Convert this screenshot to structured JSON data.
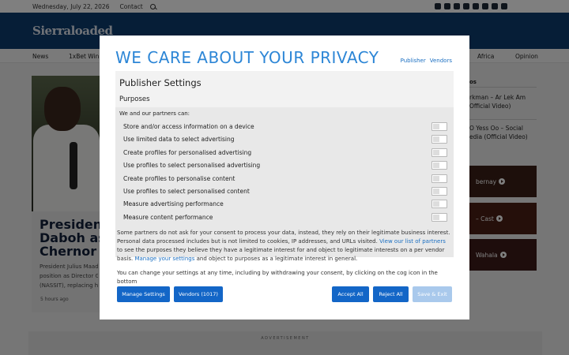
{
  "topbar": {
    "date": "Wednesday, July 22, 2026",
    "contact": "Contact"
  },
  "site": {
    "logo": "Sierraloaded"
  },
  "nav": {
    "items": [
      "News",
      "1xBet Win ",
      "Africa",
      "Opinion"
    ]
  },
  "article": {
    "headline_1": "President",
    "headline_2": "Daboh as",
    "headline_3": "Chernor M",
    "lede_1": "President Julius Maad",
    "lede_2": "position as Director G",
    "lede_3": "(NASSIT), replacing h",
    "age": "5 hours ago"
  },
  "sidebar": {
    "heading": "os",
    "item_1_l1": "rkman – Ar Lek Am",
    "item_1_l2": "Official Video)",
    "item_2_l1": "O Yess Oo – Social",
    "item_2_l2": "edia (Official Video)",
    "thumb_1": "bernay",
    "thumb_2": "– Cast",
    "thumb_3": "Wahala"
  },
  "ad": {
    "label": "ADVERTISEMENT"
  },
  "consent": {
    "title": "WE CARE ABOUT YOUR PRIVACY",
    "link_publisher": "Publisher",
    "link_vendors": "Vendors",
    "settings_title": "Publisher Settings",
    "purposes_title": "Purposes",
    "partners_intro": "We and our partners can:",
    "purposes": [
      "Store and/or access information on a device",
      "Use limited data to select advertising",
      "Create profiles for personalised advertising",
      "Use profiles to select personalised advertising",
      "Create profiles to personalise content",
      "Use profiles to select personalised content",
      "Measure advertising performance",
      "Measure content performance"
    ],
    "body_1a": "Some partners do not ask for your consent to process your data, instead, they rely on their legitimate business interest. Personal data processed includes but is not limited to cookies, IP addresses, and URLs visited.",
    "body_1_link1": "View our list of partners",
    "body_1b": "to see the purposes they believe they have a legitimate interest for and object to legitimate interests on a per vendor basis.",
    "body_1_link2": "Manage your settings",
    "body_1c": "and object to purposes as a legitimate interest in general.",
    "body_2": "You can change your settings at any time, including by withdrawing your consent, by clicking on the cog icon in the bottom",
    "btn_manage": "Manage Settings",
    "btn_vendors": "Vendors (1017)",
    "btn_accept": "Accept All",
    "btn_reject": "Reject All",
    "btn_save": "Save & Exit"
  }
}
